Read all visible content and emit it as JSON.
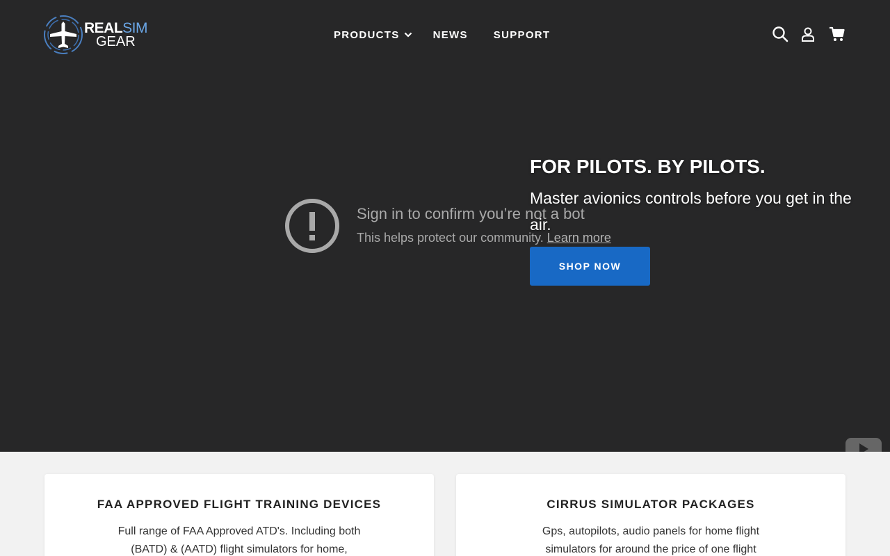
{
  "header": {
    "logo": {
      "word1": "REAL",
      "word2": "SIM",
      "word3": "GEAR"
    },
    "nav": [
      {
        "label": "PRODUCTS",
        "has_dropdown": true
      },
      {
        "label": "NEWS"
      },
      {
        "label": "SUPPORT"
      }
    ],
    "icons": [
      "search-icon",
      "account-icon",
      "cart-icon"
    ]
  },
  "video_overlay": {
    "title": "Sign in to confirm you’re not a bot",
    "subtitle": "This helps protect our community.",
    "link": "Learn more",
    "icon": "alert-circle-icon"
  },
  "hero": {
    "title": "FOR PILOTS. BY PILOTS.",
    "subtitle": "Master avionics controls before you get in the air.",
    "cta": "SHOP NOW",
    "background_color": "#272728",
    "accent_color": "#1869c5"
  },
  "cards": [
    {
      "title": "FAA APPROVED FLIGHT TRAINING DEVICES",
      "description": "Full range of FAA Approved ATD's. Including both (BATD) & (AATD) flight simulators for home,"
    },
    {
      "title": "CIRRUS SIMULATOR PACKAGES",
      "description": "Gps, autopilots, audio panels for home flight simulators for around the price of one flight"
    }
  ]
}
